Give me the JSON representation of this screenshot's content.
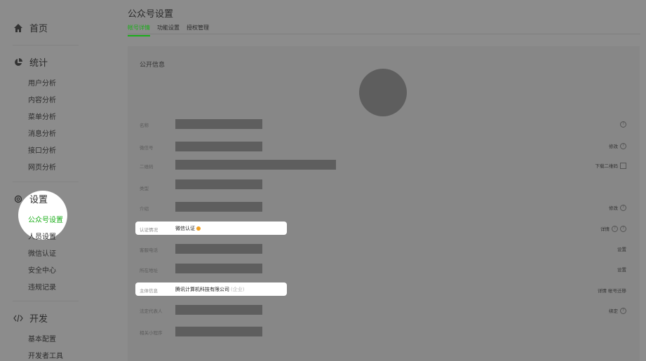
{
  "sidebar": {
    "home": "首页",
    "stats": {
      "heading": "统计",
      "items": [
        "用户分析",
        "内容分析",
        "菜单分析",
        "消息分析",
        "接口分析",
        "网页分析"
      ]
    },
    "settings": {
      "heading": "设置",
      "items": [
        "公众号设置",
        "人员设置",
        "微信认证",
        "安全中心",
        "违规记录"
      ]
    },
    "dev": {
      "heading": "开发",
      "items": [
        "基本配置",
        "开发者工具"
      ]
    }
  },
  "page": {
    "title": "公众号设置",
    "tabs": [
      "帐号详情",
      "功能设置",
      "授权管理"
    ]
  },
  "card": {
    "title": "公开信息",
    "rows": [
      {
        "label": "名称",
        "action": ""
      },
      {
        "label": "微信号",
        "action": "修改"
      },
      {
        "label": "二维码",
        "action": "下载二维码"
      },
      {
        "label": "类型",
        "action": ""
      },
      {
        "label": "介绍",
        "action": "修改"
      },
      {
        "label": "认证情况",
        "value": "微信认证",
        "action": "详情"
      },
      {
        "label": "客服电话",
        "action": "设置"
      },
      {
        "label": "所在地址",
        "action": "设置"
      },
      {
        "label": "主体信息",
        "value": "腾讯计算机科技有限公司",
        "extra": "(企业)",
        "action": "详情 帐号迁移"
      },
      {
        "label": "法定代表人",
        "action": "绑定"
      },
      {
        "label": "相关小程序",
        "action": ""
      }
    ]
  },
  "colors": {
    "accent": "#1aad19",
    "overlay": "#8c8c8c"
  },
  "icons": [
    "home-icon",
    "pie-chart-icon",
    "gear-icon",
    "code-icon",
    "help-circle-icon",
    "qrcode-icon",
    "verified-icon"
  ]
}
